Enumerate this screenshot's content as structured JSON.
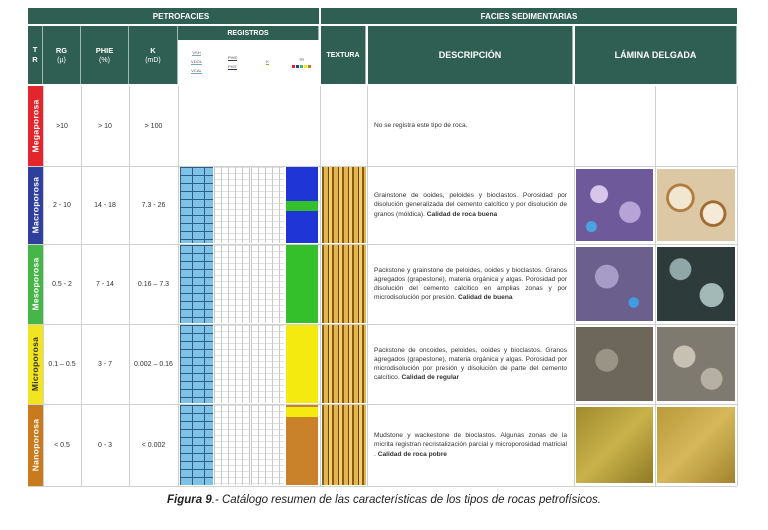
{
  "headers": {
    "petrofacies": "PETROFACIES",
    "facies_sedimentarias": "FACIES SEDIMENTARIAS",
    "tr": "T R",
    "rg": "RG",
    "rg_unit": "(µ)",
    "phie": "PHIE",
    "phie_unit": "(%)",
    "k": "K",
    "k_unit": "(mD)",
    "registros": "REGISTROS",
    "textura": "TEXTURA",
    "descripcion": "DESCRIPCIÓN",
    "lamina": "LÁMINA DELGADA"
  },
  "registros_legend": {
    "track1": [
      "VSH",
      "VDOL",
      "VCAL"
    ],
    "track2": [
      "PHIE",
      "PHIT"
    ],
    "track3": [
      "K"
    ],
    "track4": [
      "TR"
    ]
  },
  "rows": [
    {
      "rock_type": "Megaporosa",
      "color": "#e2262b",
      "rg": ">10",
      "phie": "> 10",
      "k": "> 100",
      "registros_fill": "",
      "description": "No se registra este tipo de roca.",
      "quality": ""
    },
    {
      "rock_type": "Macroporosa",
      "color": "#2f3f9e",
      "rg": "2 - 10",
      "phie": "14 - 18",
      "k": "7.3 - 26",
      "registros_fill": "#1f35d6",
      "description": "Grainstone de ooides, peloides y bioclastos. Porosidad por disolución generalizada del cemento calcítico y por disolución de granos (móldica).",
      "quality": "Calidad de roca buena"
    },
    {
      "rock_type": "Mesoporosa",
      "color": "#46b649",
      "rg": "0.5 - 2",
      "phie": "7 - 14",
      "k": "0.16 – 7.3",
      "registros_fill": "#33c02a",
      "description": "Packstone y grainstone de peloides, ooides y bioclastos. Granos agregados (grapestone), materia orgánica y algas. Porosidad por disolución del cemento calcítico en amplias zonas y por microdisolución por presión.",
      "quality": "Calidad de buena"
    },
    {
      "rock_type": "Microporosa",
      "color": "#f2e41f",
      "rg": "0.1 – 0.5",
      "phie": "3 - 7",
      "k": "0.002 – 0.16",
      "registros_fill": "#f4ea10",
      "description": "Packstone de oncoides, peloides, ooides y bioclastos. Granos agregados (grapestone), materia orgánica y algas. Porosidad por microdisolución por presión y disolución de parte del cemento calcítico.",
      "quality": "Calidad de regular"
    },
    {
      "rock_type": "Nanoporosa",
      "color": "#c97a1c",
      "rg": "< 0.5",
      "phie": "0 - 3",
      "k": "< 0.002",
      "registros_fill": "#c9822a",
      "description": "Mudstone y wackestone de bioclastos. Algunas zonas de la micrita registran recristalización parcial y microporosidad matricial .",
      "quality": "Calidad de roca pobre"
    }
  ],
  "caption": {
    "label": "Figura 9",
    "text": ".- Catálogo resumen de las características de los tipos de rocas petrofísicos."
  }
}
